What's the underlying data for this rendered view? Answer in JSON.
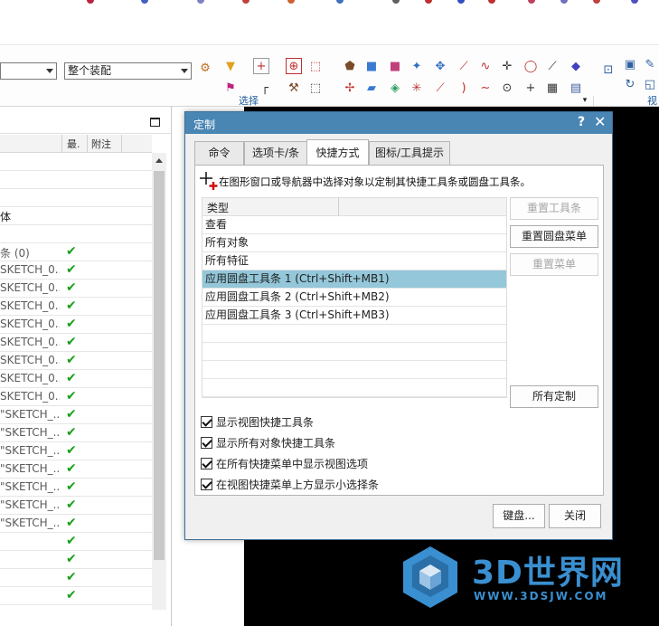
{
  "ribbon": {
    "assembly_scope": "整个装配",
    "first_combo": "",
    "select_group": "选择",
    "view_group": "视"
  },
  "navigator": {
    "col_latest": "最.",
    "col_note": "附注",
    "rows": [
      {
        "label": "",
        "check": false
      },
      {
        "label": "",
        "check": false
      },
      {
        "label": "",
        "check": false
      },
      {
        "label": "体",
        "check": false,
        "dark": true
      },
      {
        "label": "",
        "check": false
      },
      {
        "label": "条 (0)",
        "check": true
      },
      {
        "label": "SKETCH_0...",
        "check": true
      },
      {
        "label": "SKETCH_0...",
        "check": true
      },
      {
        "label": "SKETCH_0...",
        "check": true
      },
      {
        "label": "SKETCH_0...",
        "check": true
      },
      {
        "label": "SKETCH_0...",
        "check": true
      },
      {
        "label": "SKETCH_0...",
        "check": true
      },
      {
        "label": "SKETCH_0...",
        "check": true
      },
      {
        "label": "SKETCH_0...",
        "check": true
      },
      {
        "label": "\"SKETCH_...",
        "check": true
      },
      {
        "label": "\"SKETCH_...",
        "check": true
      },
      {
        "label": "\"SKETCH_...",
        "check": true
      },
      {
        "label": "\"SKETCH_...",
        "check": true
      },
      {
        "label": "\"SKETCH_...",
        "check": true
      },
      {
        "label": "\"SKETCH_...",
        "check": true
      },
      {
        "label": "\"SKETCH_...",
        "check": true
      },
      {
        "label": "",
        "check": true
      },
      {
        "label": "",
        "check": true
      },
      {
        "label": "",
        "check": true
      },
      {
        "label": "",
        "check": true
      }
    ]
  },
  "dialog": {
    "title": "定制",
    "help": "?",
    "close": "✕",
    "tabs": [
      "命令",
      "选项卡/条",
      "快捷方式",
      "图标/工具提示"
    ],
    "active_tab": 2,
    "hint": "在图形窗口或导航器中选择对象以定制其快捷工具条或圆盘工具条。",
    "list_header": "类型",
    "list_items": [
      {
        "label": "查看",
        "selected": false
      },
      {
        "label": "所有对象",
        "selected": false
      },
      {
        "label": "所有特征",
        "selected": false
      },
      {
        "label": "应用圆盘工具条 1 (Ctrl+Shift+MB1)",
        "selected": true
      },
      {
        "label": "应用圆盘工具条 2 (Ctrl+Shift+MB2)",
        "selected": false
      },
      {
        "label": "应用圆盘工具条 3 (Ctrl+Shift+MB3)",
        "selected": false
      },
      {
        "label": "",
        "selected": false
      },
      {
        "label": "",
        "selected": false
      },
      {
        "label": "",
        "selected": false
      },
      {
        "label": "",
        "selected": false
      }
    ],
    "side_buttons": {
      "reset_toolbar": "重置工具条",
      "reset_radial": "重置圆盘菜单",
      "reset_menu": "重置菜单",
      "all_custom": "所有定制"
    },
    "checkboxes": [
      {
        "label": "显示视图快捷工具条",
        "checked": true
      },
      {
        "label": "显示所有对象快捷工具条",
        "checked": true
      },
      {
        "label": "在所有快捷菜单中显示视图选项",
        "checked": true
      },
      {
        "label": "在视图快捷菜单上方显示小选择条",
        "checked": true
      }
    ],
    "keyboard_button": "键盘...",
    "close_button": "关闭"
  },
  "watermark": {
    "brand": "3D世界网",
    "url": "WWW.3DSJW.COM"
  },
  "colors": {
    "title_bar": "#4a86b4",
    "selection": "#93c7d9",
    "check_green": "#18a018",
    "brand_blue": "#3a8fd0"
  }
}
